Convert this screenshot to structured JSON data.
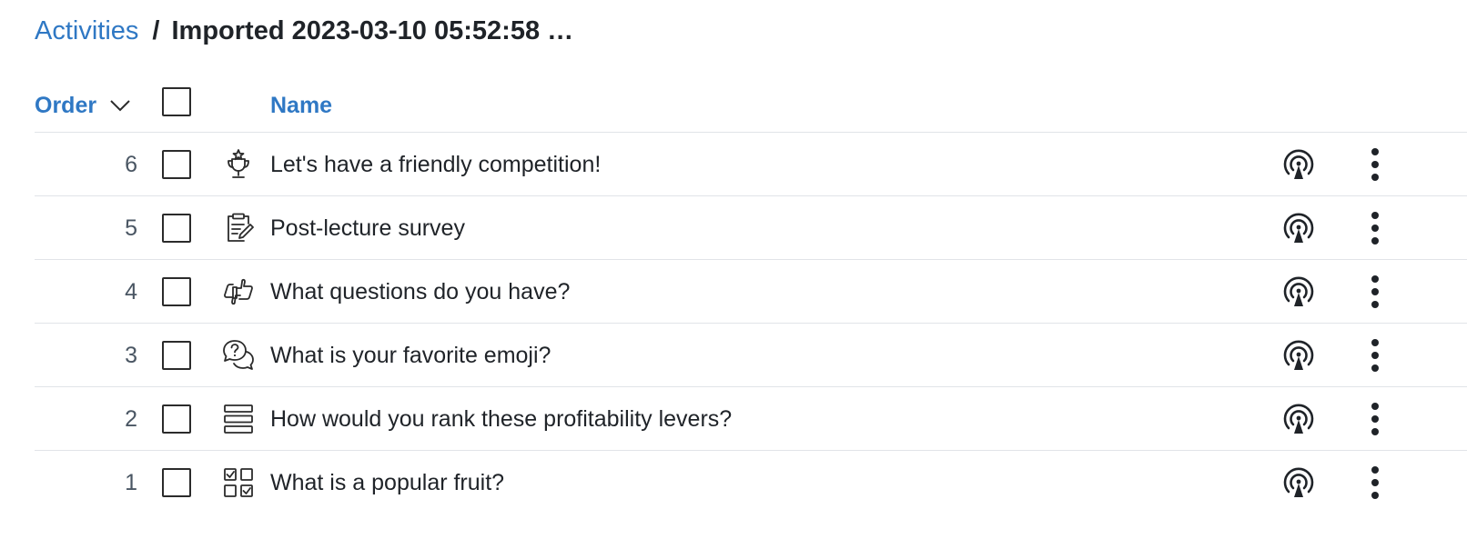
{
  "breadcrumb": {
    "parent": "Activities",
    "separator": "/",
    "current": "Imported 2023-03-10 05:52:58 …"
  },
  "table": {
    "sort_label": "Order",
    "sort_icon": "chevron-down-icon",
    "name_header": "Name",
    "rows": [
      {
        "order": "6",
        "title": "Let's have a friendly competition!",
        "icon": "trophy-icon"
      },
      {
        "order": "5",
        "title": "Post-lecture survey",
        "icon": "clipboard-edit-icon"
      },
      {
        "order": "4",
        "title": "What questions do you have?",
        "icon": "thumbs-icon"
      },
      {
        "order": "3",
        "title": "What is your favorite emoji?",
        "icon": "question-bubbles-icon"
      },
      {
        "order": "2",
        "title": "How would you rank these profitability levers?",
        "icon": "ranking-icon"
      },
      {
        "order": "1",
        "title": "What is a popular fruit?",
        "icon": "multiple-choice-icon"
      }
    ],
    "row_action_icons": [
      "broadcast-icon",
      "kebab-menu-icon"
    ]
  },
  "colors": {
    "accent": "#2f78c4",
    "text": "#1f2328",
    "muted": "#4a5663",
    "divider": "#e1e4e8"
  }
}
